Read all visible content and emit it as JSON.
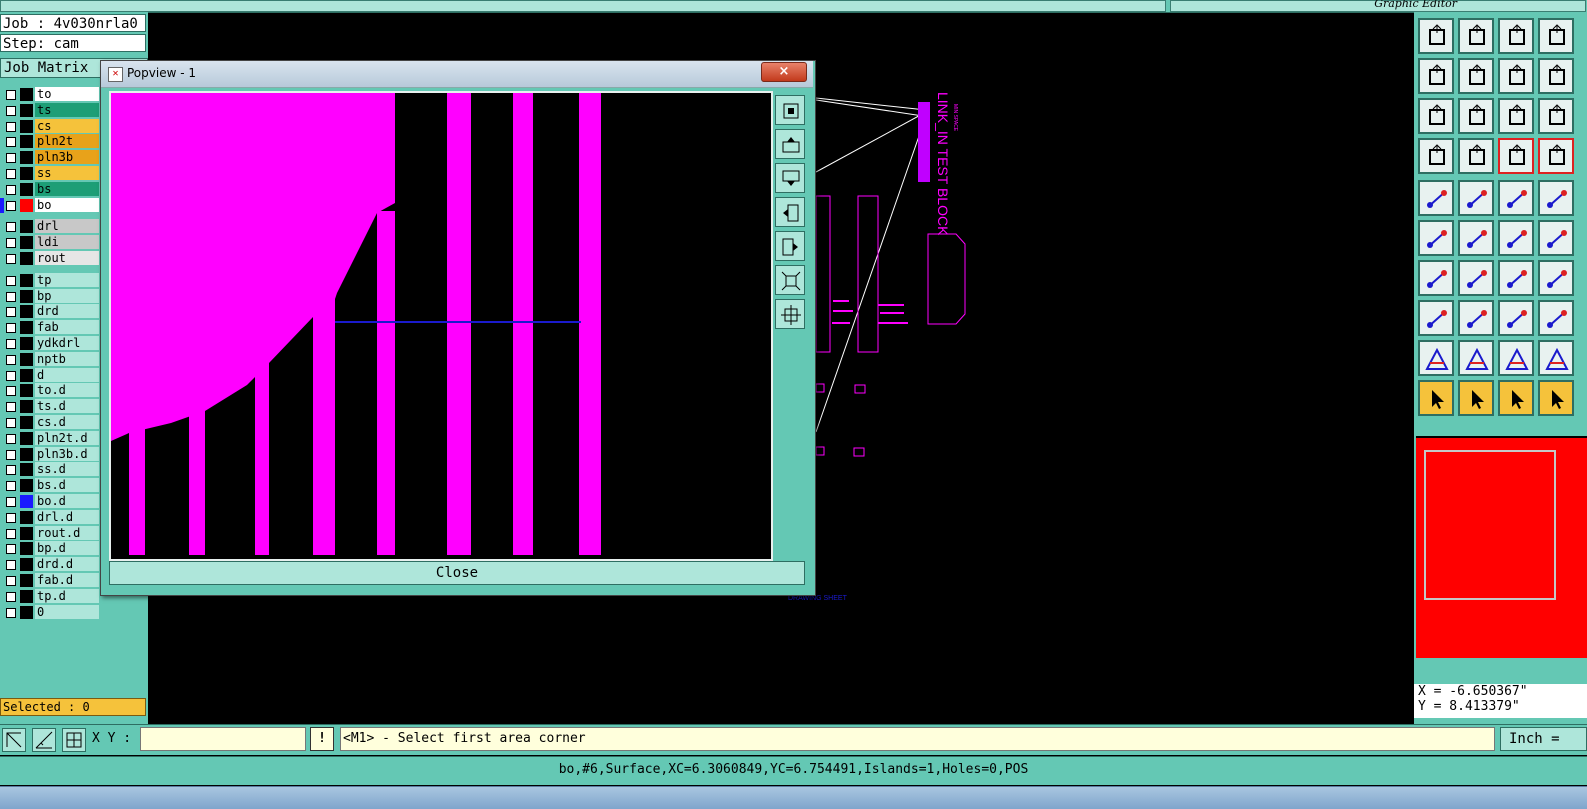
{
  "top_bar": {
    "title": "Graphic Editor"
  },
  "left_panel": {
    "job": "Job : 4v030nrla0",
    "step": "Step: cam",
    "matrix_header": "Job Matrix",
    "layer_groups": [
      [
        {
          "name": "to",
          "color": "#ffffff"
        },
        {
          "name": "ts",
          "color": "#1d9e76"
        },
        {
          "name": "cs",
          "color": "#f5c23b"
        },
        {
          "name": "pln2t",
          "color": "#e8a21a"
        },
        {
          "name": "pln3b",
          "color": "#e8a21a"
        },
        {
          "name": "ss",
          "color": "#f5c23b"
        },
        {
          "name": "bs",
          "color": "#1d9e76"
        },
        {
          "name": "bo",
          "color": "#ffffff",
          "active": true
        }
      ],
      [
        {
          "name": "drl",
          "color": "#c8c8c8"
        },
        {
          "name": "ldi",
          "color": "#c8c8c8"
        },
        {
          "name": "rout",
          "color": "#e6e6e6"
        }
      ],
      [
        {
          "name": "tp"
        },
        {
          "name": "bp"
        },
        {
          "name": "drd"
        },
        {
          "name": "fab"
        },
        {
          "name": "ydkdrl"
        },
        {
          "name": "nptb"
        },
        {
          "name": "d"
        },
        {
          "name": "to.d"
        },
        {
          "name": "ts.d"
        },
        {
          "name": "cs.d"
        },
        {
          "name": "pln2t.d"
        },
        {
          "name": "pln3b.d"
        },
        {
          "name": "ss.d"
        },
        {
          "name": "bs.d"
        },
        {
          "name": "bo.d",
          "marker": "#1a1aff"
        },
        {
          "name": "drl.d"
        },
        {
          "name": "rout.d"
        },
        {
          "name": "bp.d"
        },
        {
          "name": "drd.d"
        },
        {
          "name": "fab.d"
        },
        {
          "name": "tp.d"
        },
        {
          "name": "0"
        }
      ]
    ],
    "selected": "Selected : 0"
  },
  "canvas": {
    "board_text_1": "LINK_IN TEST BLOCK",
    "board_text_2": "MIN SPACE",
    "board_label_bottom": "DRAWING SHEET"
  },
  "popup": {
    "title": "Popview - 1",
    "close_x": "×",
    "close_button": "Close",
    "side_buttons": [
      "zoom-home-icon",
      "zoom-up-icon",
      "zoom-down-icon",
      "pan-left-icon",
      "pan-right-icon",
      "fit-icon",
      "center-icon"
    ]
  },
  "right_toolbar": {
    "coord_x": "X = -6.650367\"",
    "coord_y": "Y = 8.413379\"",
    "preview_color": "#ff0000"
  },
  "command_bar": {
    "xy_label": "X Y :",
    "xy_value": "",
    "warn_label": "!",
    "prompt": "<M1> - Select first area corner",
    "units": "Inch ="
  },
  "status_bar": {
    "text": "bo,#6,Surface,XC=6.3060849,YC=6.754491,Islands=1,Holes=0,POS"
  },
  "colors": {
    "panel": "#64c8b4",
    "panel_light": "#aee6da",
    "magenta": "#ff00ff",
    "blue_line": "#1a1acc"
  }
}
